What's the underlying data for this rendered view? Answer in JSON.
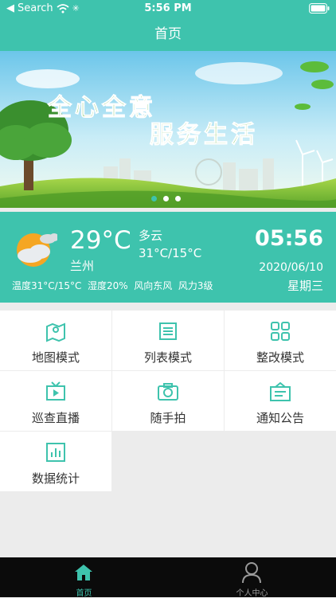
{
  "status_bar": {
    "carrier": "Search",
    "time": "5:56 PM"
  },
  "nav": {
    "title": "首页"
  },
  "banner": {
    "slogan_line1": "全心全意",
    "slogan_line2": "服务生活",
    "page_count": 3,
    "active_page": 1
  },
  "weather": {
    "temperature": "29°C",
    "condition": "多云",
    "range": "31°C/15°C",
    "city": "兰州",
    "details": "温度31°C/15°C  湿度20%  风向东风  风力3级",
    "time": "05:56",
    "date": "2020/06/10",
    "weekday": "星期三",
    "icon": "partly-cloudy-icon"
  },
  "menu": [
    {
      "label": "地图模式",
      "icon": "map-pin-icon"
    },
    {
      "label": "列表模式",
      "icon": "list-document-icon"
    },
    {
      "label": "整改模式",
      "icon": "grid-icon"
    },
    {
      "label": "巡查直播",
      "icon": "live-play-icon"
    },
    {
      "label": "随手拍",
      "icon": "camera-icon"
    },
    {
      "label": "通知公告",
      "icon": "notice-icon"
    },
    {
      "label": "数据统计",
      "icon": "bar-chart-icon"
    }
  ],
  "tabs": [
    {
      "label": "首页",
      "icon": "home-icon",
      "active": true
    },
    {
      "label": "个人中心",
      "icon": "user-icon",
      "active": false
    }
  ],
  "colors": {
    "accent": "#3ec3ad",
    "tab_active": "#3ec3ad",
    "tab_inactive": "#9a9a9a"
  }
}
